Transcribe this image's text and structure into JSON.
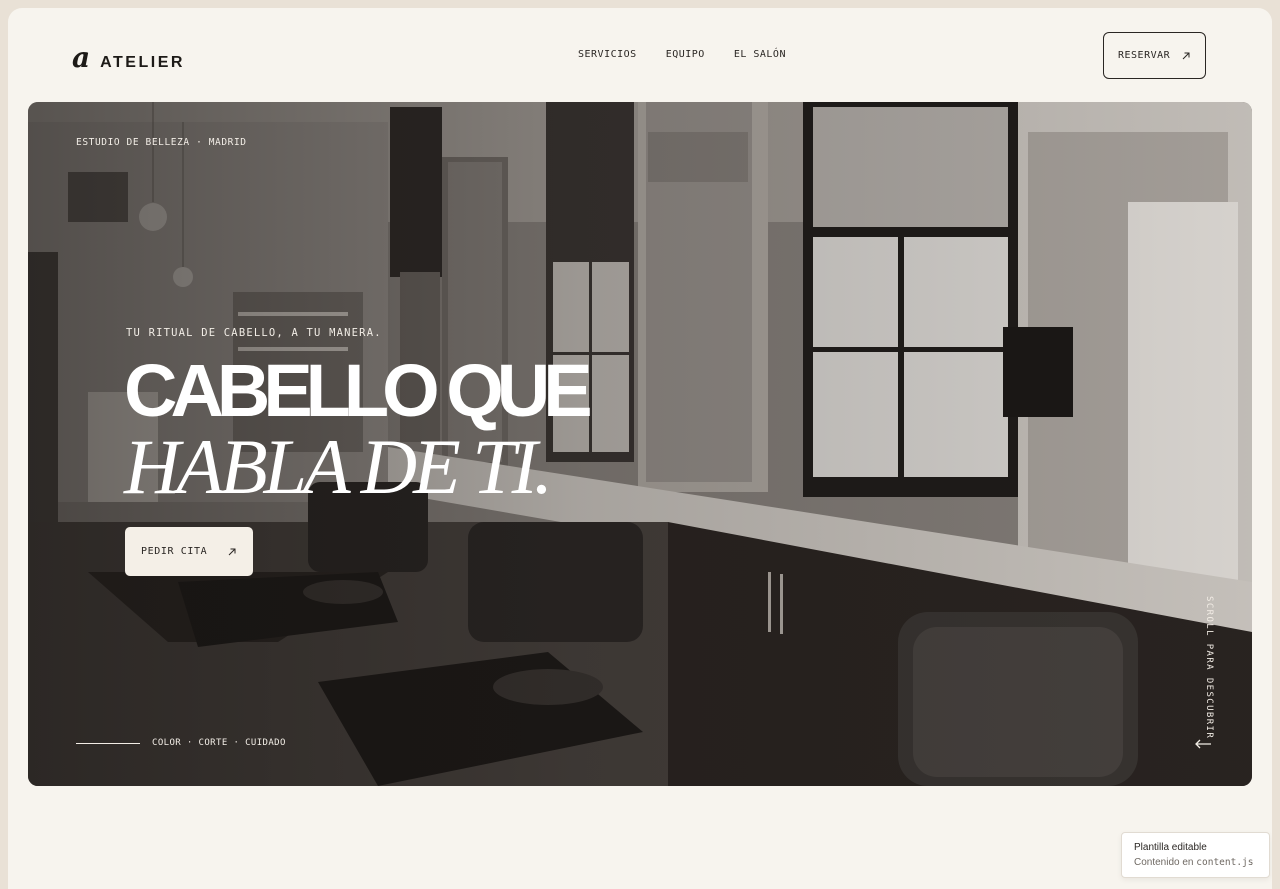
{
  "brand": {
    "mark": "a",
    "name": "ATELIER"
  },
  "nav": {
    "items": [
      "SERVICIOS",
      "EQUIPO",
      "EL SALÓN"
    ]
  },
  "header": {
    "cta_label": "RESERVAR",
    "cta_icon": "arrow-up-right-icon"
  },
  "hero": {
    "kicker": "ESTUDIO DE BELLEZA · MADRID",
    "tagline": "TU RITUAL DE CABELLO, A TU MANERA.",
    "headline_line1": "CABELLO QUE",
    "headline_line2": "HABLA DE TI.",
    "cta_label": "PEDIR CITA",
    "cta_icon": "arrow-up-right-icon",
    "footer_text": "COLOR · CORTE · CUIDADO",
    "scroll_label": "SCROLL PARA DESCUBRIR",
    "scroll_icon": "arrow-left-icon",
    "image_subject": "salon interior with styling chairs, mirrors and windows"
  },
  "toast": {
    "title": "Plantilla editable",
    "text_prefix": "Contenido en ",
    "text_code": "content.js"
  },
  "colors": {
    "page_bg": "#f7f4ee",
    "outer_bg": "#e9e1d6",
    "ink": "#2a2623",
    "hero_text": "#ffffff",
    "cta_bg": "#f4efe7"
  }
}
